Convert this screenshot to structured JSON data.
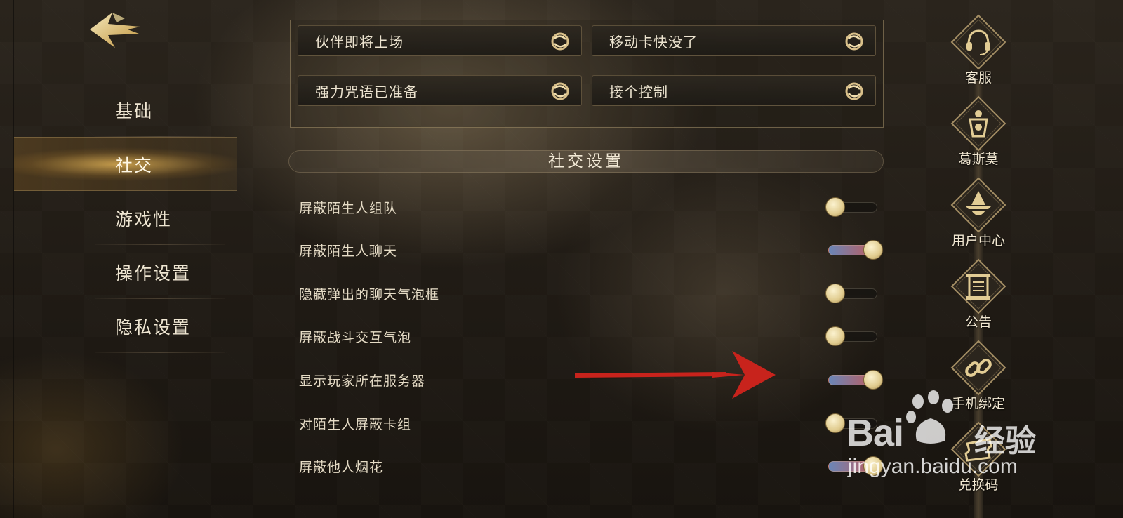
{
  "sidebar": {
    "items": [
      {
        "label": "基础",
        "active": false
      },
      {
        "label": "社交",
        "active": true
      },
      {
        "label": "游戏性",
        "active": false
      },
      {
        "label": "操作设置",
        "active": false
      },
      {
        "label": "隐私设置",
        "active": false
      }
    ]
  },
  "quick_phrases": [
    {
      "label": "伙伴即将上场",
      "icon": "swirl-icon"
    },
    {
      "label": "移动卡快没了",
      "icon": "swirl-icon"
    },
    {
      "label": "强力咒语已准备",
      "icon": "swirl-icon"
    },
    {
      "label": "接个控制",
      "icon": "swirl-icon"
    }
  ],
  "section": {
    "title": "社交设置"
  },
  "settings": [
    {
      "label": "屏蔽陌生人组队",
      "enabled": false
    },
    {
      "label": "屏蔽陌生人聊天",
      "enabled": true
    },
    {
      "label": "隐藏弹出的聊天气泡框",
      "enabled": false
    },
    {
      "label": "屏蔽战斗交互气泡",
      "enabled": false
    },
    {
      "label": "显示玩家所在服务器",
      "enabled": true
    },
    {
      "label": "对陌生人屏蔽卡组",
      "enabled": false
    },
    {
      "label": "屏蔽他人烟花",
      "enabled": true
    }
  ],
  "rail": {
    "items": [
      {
        "label": "客服",
        "icon": "headset-icon"
      },
      {
        "label": "葛斯莫",
        "icon": "character-badge-icon"
      },
      {
        "label": "用户中心",
        "icon": "wizard-hat-icon"
      },
      {
        "label": "公告",
        "icon": "scroll-icon"
      },
      {
        "label": "手机绑定",
        "icon": "link-icon"
      },
      {
        "label": "兑换码",
        "icon": "ticket-icon"
      }
    ]
  },
  "watermark": {
    "brand": "Bai",
    "brand_cn": "经验",
    "url": "jingyan.baidu.com"
  },
  "colors": {
    "accent_gold": "#e0cb8e",
    "toggle_on_left": "#6a86b8",
    "toggle_on_right": "#c25a5a",
    "arrow_red": "#c8231c"
  }
}
